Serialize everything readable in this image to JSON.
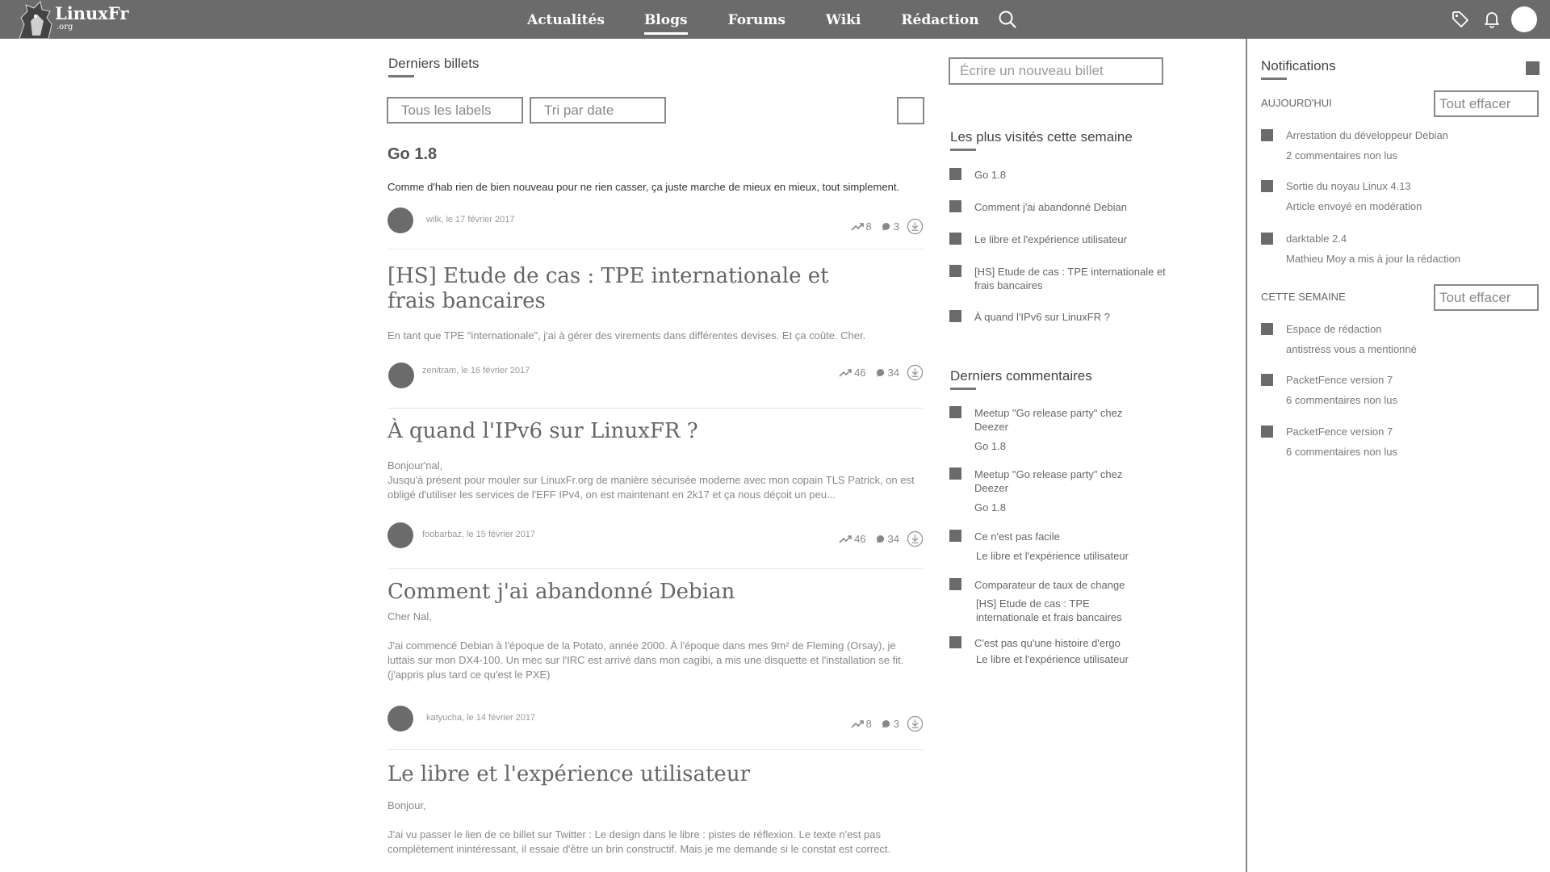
{
  "header": {
    "logo_text": "LinuxFr",
    "logo_sub": ".org",
    "nav": [
      {
        "label": "Actualités",
        "active": false
      },
      {
        "label": "Blogs",
        "active": true
      },
      {
        "label": "Forums",
        "active": false
      },
      {
        "label": "Wiki",
        "active": false
      },
      {
        "label": "Rédaction",
        "active": false
      }
    ],
    "icons": [
      "search-icon",
      "tag-icon",
      "bell-icon",
      "avatar"
    ]
  },
  "main": {
    "section_title": "Derniers billets",
    "filters": {
      "labels": "Tous les labels",
      "sort": "Tri par date"
    },
    "articles": [
      {
        "title": "Go 1.8",
        "body": "Comme d'hab rien de bien nouveau pour ne rien casser, ça juste marche de mieux en mieux, tout simplement.",
        "author": "wilk, le 17 février 2017",
        "trend": "8",
        "comments": "3"
      },
      {
        "title": "[HS] Etude de cas : TPE internationale et frais bancaires",
        "body": "En tant que TPE \"internationale\", j'ai à gérer des virements dans différentes devises. Et ça coûte. Cher.",
        "author": "zenitram, le 16 février 2017",
        "trend": "46",
        "comments": "34"
      },
      {
        "title": "À quand l'IPv6 sur LinuxFR ?",
        "body_intro": "Bonjour'nal,",
        "body": "Jusqu'à présent pour mouler sur LinuxFr.org de manière sécurisée moderne avec mon copain TLS Patrick, on est obligé d'utiliser les services de l'EFF IPv4, on est maintenant en 2k17 et ça nous déçoit un peu...",
        "author": "foobarbaz, le 15 février 2017",
        "trend": "46",
        "comments": "34"
      },
      {
        "title": "Comment j'ai abandonné Debian",
        "body_intro": "Cher Nal,",
        "body": "J'ai commencé Debian à l'époque de la Potato, année 2000. À l'époque dans mes 9m² de Fleming (Orsay), je luttais sur mon DX4-100. Un mec sur l'IRC est arrivé dans mon cagibi, a mis une disquette et l'installation se fit. (j'appris plus tard ce qu'est le PXE)",
        "author": "katyucha, le 14 février 2017",
        "trend": "8",
        "comments": "3"
      },
      {
        "title": "Le libre et l'expérience utilisateur",
        "body_intro": "Bonjour,",
        "body": "J'ai vu passer le lien de ce billet sur Twitter : Le design dans le libre : pistes de réflexion. Le texte n'est pas complètement inintéressant, il essaie d'être un brin constructif. Mais je me demande si le constat est correct."
      }
    ]
  },
  "sidebar": {
    "write_placeholder": "Écrire un nouveau billet",
    "most_visited_title": "Les plus visités cette semaine",
    "most_visited": [
      "Go 1.8",
      "Comment j'ai abandonné Debian",
      "Le libre et l'expérience utilisateur",
      "[HS] Etude de cas : TPE internationale et frais bancaires",
      "À quand l'IPv6 sur LinuxFR ?"
    ],
    "comments_title": "Derniers commentaires",
    "comments": [
      {
        "comment": "Meetup \"Go release party\" chez Deezer",
        "article": "Go 1.8"
      },
      {
        "comment": "Meetup \"Go release party\" chez Deezer",
        "article": "Go 1.8"
      },
      {
        "comment": "Ce n'est pas facile",
        "article": "Le libre et l'expérience utilisateur"
      },
      {
        "comment": "Comparateur de taux de change",
        "article": "[HS] Etude de cas : TPE internationale et frais bancaires"
      },
      {
        "comment": "C'est pas qu'une histoire d'ergo",
        "article": "Le libre et l'expérience utilisateur"
      }
    ]
  },
  "notifications": {
    "title": "Notifications",
    "today_label": "AUJOURD'HUI",
    "week_label": "CETTE SEMAINE",
    "clear_label": "Tout effacer",
    "today": [
      {
        "title": "Arrestation du développeur Debian",
        "detail": "2 commentaires non lus"
      },
      {
        "title": "Sortie du noyau Linux 4.13",
        "detail": "Article envoyé en modération"
      },
      {
        "title": "darktable 2.4",
        "detail": "Mathieu Moy a mis à jour la rédaction"
      }
    ],
    "week": [
      {
        "title": "Espace de rédaction",
        "detail": "antistress vous a mentionné"
      },
      {
        "title": "PacketFence version 7",
        "detail": "6 commentaires non lus"
      },
      {
        "title": "PacketFence version 7",
        "detail": "6 commentaires non lus"
      }
    ]
  },
  "colors": {
    "topbar": "#6b6b6b",
    "text": "#555555",
    "muted": "#888888"
  }
}
